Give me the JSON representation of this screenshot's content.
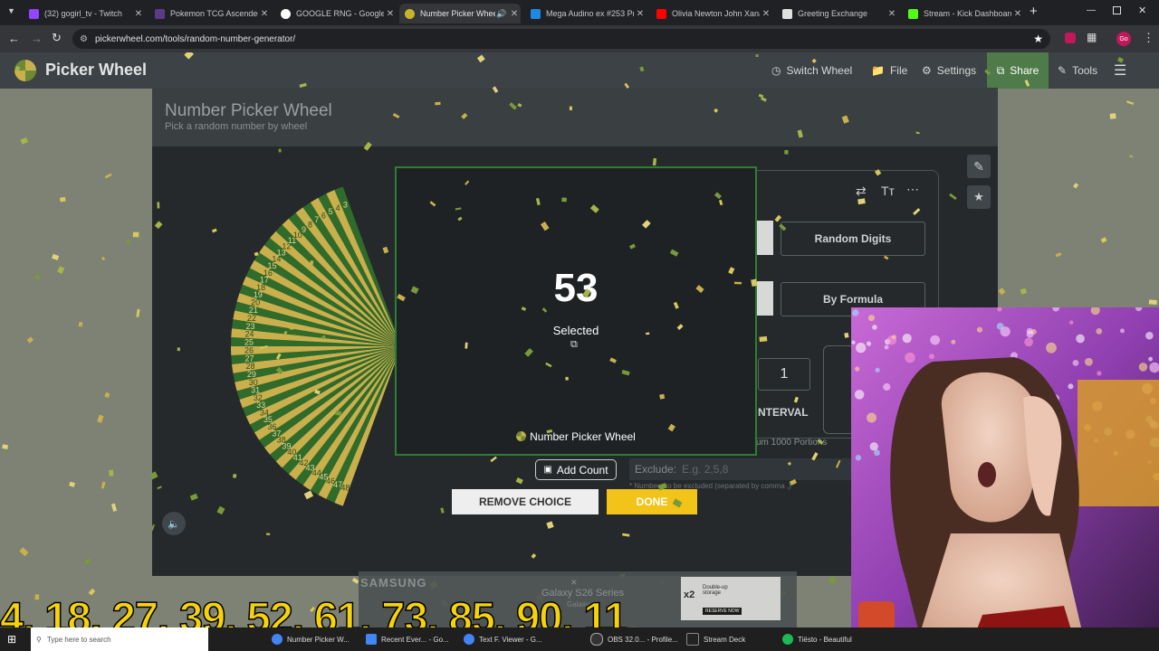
{
  "browser": {
    "tabs": [
      {
        "title": "(32) gogirl_tv - Twitch",
        "color": "#9146ff"
      },
      {
        "title": "Pokemon TCG Ascended",
        "color": "#5b3a8a"
      },
      {
        "title": "GOOGLE RNG - Google S",
        "color": "#ffffff"
      },
      {
        "title": "Number Picker Wheel",
        "color": "#c8b42a"
      },
      {
        "title": "Mega Audino ex #253 Pri",
        "color": "#1e88e5"
      },
      {
        "title": "Olivia Newton John Xana",
        "color": "#ff0000"
      },
      {
        "title": "Greeting Exchange",
        "color": "#e0e0e0"
      },
      {
        "title": "Stream - Kick Dashboard",
        "color": "#53fc18"
      }
    ],
    "url": "pickerwheel.com/tools/random-number-generator/",
    "new_tab": "+",
    "profile_badge": "Go"
  },
  "site": {
    "logo": "Picker Wheel",
    "nav": {
      "switch": "Switch Wheel",
      "file": "File",
      "settings": "Settings",
      "share": "Share",
      "tools": "Tools"
    },
    "title": "Number Picker Wheel",
    "subtitle": "Pick a random number by wheel"
  },
  "wheel": {
    "numbers": [
      "41",
      "40",
      "39",
      "38",
      "37",
      "36",
      "35",
      "34",
      "33",
      "32",
      "31",
      "30",
      "29",
      "28",
      "27",
      "26",
      "25",
      "24",
      "23",
      "22",
      "21",
      "20",
      "19",
      "18",
      "17",
      "16",
      "15"
    ],
    "top_numbers": [
      "48",
      "47",
      "46",
      "45",
      "44",
      "43",
      "42"
    ],
    "bottom_numbers": [
      "14",
      "13",
      "12",
      "11",
      "10",
      "9",
      "8",
      "7",
      "6",
      "5",
      "4",
      "3"
    ],
    "color_green": "#2f6b2a",
    "color_gold": "#c9b04c"
  },
  "panel": {
    "random_digits": "Random Digits",
    "by_formula": "By Formula",
    "count_value": "1",
    "interval_label": "NTERVAL",
    "max_note": "um 1000 Portions",
    "exclude_label": "Exclude:",
    "exclude_placeholder": "E.g. 2,5,8",
    "exclude_note": "* Numbers to be excluded (separated by comma ,)"
  },
  "result": {
    "number": "53",
    "label": "Selected",
    "brand": "Number Picker Wheel"
  },
  "buttons": {
    "add_count": "Add Count",
    "remove": "REMOVE CHOICE",
    "done": "DONE"
  },
  "ad": {
    "brand": "SAMSUNG",
    "product": "Galaxy S26 Series",
    "sub": "Galaxy AI",
    "promo_badge": "x2",
    "promo_text": "Double-up storage",
    "promo_btn": "RESERVE NOW"
  },
  "overlay_numbers": "4, 18, 27, 39, 52, 61, 73, 85, 90, 11",
  "taskbar": {
    "search": "Type here to search",
    "items": [
      "Number Picker W...",
      "Recent Ever... - Go...",
      "Text F. Viewer - G...",
      "OBS 32.0... - Profile...",
      "Stream Deck",
      "Tiësto - Beautiful"
    ]
  }
}
